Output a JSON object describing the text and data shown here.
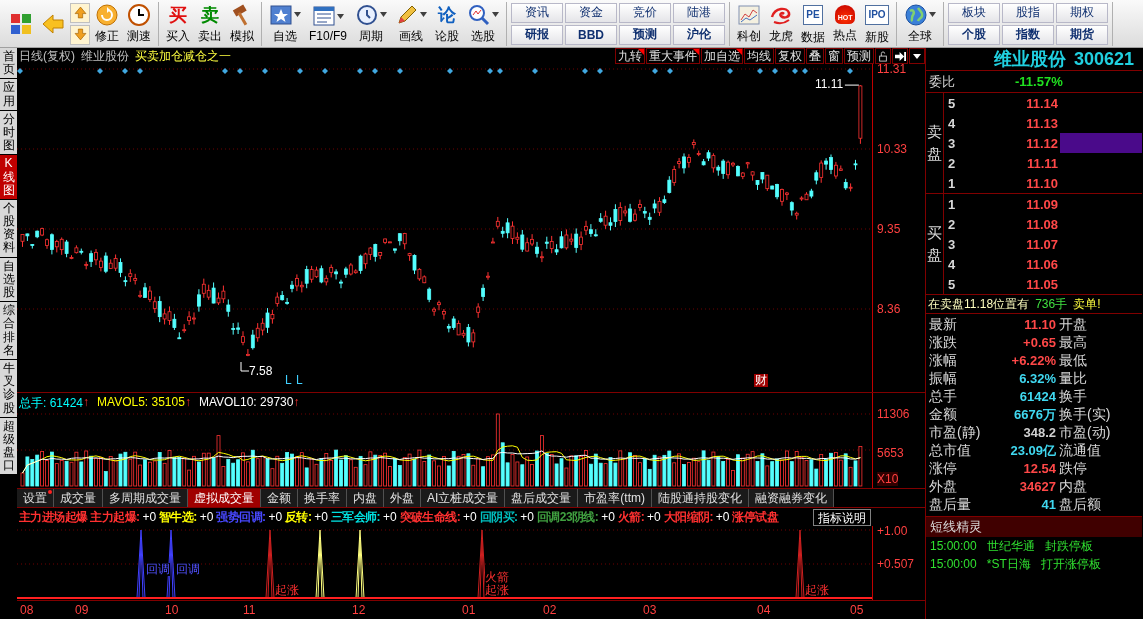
{
  "toolbar": {
    "groups": [
      {
        "items": [
          {
            "kind": "icon"
          },
          {
            "kind": "icon"
          },
          {
            "kind": "updown"
          },
          {
            "kind": "icon",
            "label": "修正"
          },
          {
            "kind": "icon",
            "label": "测速"
          }
        ]
      },
      {
        "items": [
          {
            "kind": "glyph",
            "glyph": "买",
            "color": "#e01010",
            "label": "买入"
          },
          {
            "kind": "glyph",
            "glyph": "卖",
            "color": "#008a00",
            "label": "卖出"
          },
          {
            "kind": "icon",
            "label": "模拟"
          }
        ]
      },
      {
        "items": [
          {
            "kind": "icon",
            "label": "自选",
            "dropdown": true
          },
          {
            "kind": "icon",
            "label": "F10/F9",
            "dropdown": true
          },
          {
            "kind": "icon",
            "label": "周期",
            "dropdown": true
          },
          {
            "kind": "icon",
            "label": "画线",
            "dropdown": true
          },
          {
            "kind": "glyph",
            "glyph": "论",
            "color": "#1060c0",
            "label": "论股"
          },
          {
            "kind": "icon",
            "label": "选股",
            "dropdown": true
          }
        ]
      },
      {
        "items": [
          {
            "kind": "pair",
            "top": "资讯",
            "bottom": "研报"
          },
          {
            "kind": "pair",
            "top": "资金",
            "bottom": "BBD"
          },
          {
            "kind": "pair",
            "top": "竞价",
            "bottom": "预测"
          },
          {
            "kind": "pair",
            "top": "陆港",
            "bottom": "沪伦"
          }
        ]
      },
      {
        "items": [
          {
            "kind": "icon",
            "label": "科创"
          },
          {
            "kind": "icon",
            "label": "龙虎"
          },
          {
            "kind": "badge",
            "glyph": "PE",
            "label": "数据"
          },
          {
            "kind": "flame",
            "glyph": "HOT",
            "label": "热点"
          },
          {
            "kind": "badge",
            "glyph": "IPO",
            "label": "新股"
          }
        ]
      },
      {
        "items": [
          {
            "kind": "icon",
            "label": "全球",
            "dropdown": true
          }
        ]
      },
      {
        "items": [
          {
            "kind": "pair",
            "top": "板块",
            "bottom": "个股"
          },
          {
            "kind": "pair",
            "top": "股指",
            "bottom": "指数"
          },
          {
            "kind": "pair",
            "top": "期权",
            "bottom": "期货"
          }
        ]
      }
    ]
  },
  "left_tabs": [
    {
      "label": "首页",
      "selected": false
    },
    {
      "label": "应用",
      "selected": false
    },
    {
      "label": "分时图",
      "selected": false
    },
    {
      "label": "K线图",
      "selected": true
    },
    {
      "label": "个股资料",
      "selected": false
    },
    {
      "label": "自选股",
      "selected": false
    },
    {
      "label": "综合排名",
      "selected": false
    },
    {
      "label": "牛叉诊股",
      "selected": false
    },
    {
      "label": "超级盘口",
      "selected": false
    }
  ],
  "chart_header": {
    "period": "日线(复权)",
    "stock": "维业股份",
    "indicator": "买卖加仓减仓之一",
    "buttons": [
      {
        "label": "九转",
        "flagged": true
      },
      {
        "label": "重大事件",
        "flagged": true
      },
      {
        "label": "加自选",
        "flagged": true
      },
      {
        "label": "均线",
        "flagged": false
      },
      {
        "label": "复权",
        "flagged": false
      },
      {
        "label": "叠",
        "flagged": false
      },
      {
        "label": "窗",
        "flagged": false
      },
      {
        "label": "预测",
        "flagged": false
      }
    ]
  },
  "main_chart": {
    "y_labels": [
      "11.31",
      "10.33",
      "9.35",
      "8.36"
    ],
    "annotations": [
      {
        "kind": "high",
        "text": "11.11"
      },
      {
        "kind": "low",
        "text": "7.58"
      },
      {
        "kind": "flag",
        "text": "L"
      },
      {
        "kind": "flag",
        "text": "L"
      },
      {
        "kind": "finance",
        "text": "财"
      }
    ]
  },
  "volume_chart": {
    "legend": [
      {
        "label": "总手:",
        "value": "61424",
        "arrow": "↑",
        "color": "#00ffff"
      },
      {
        "label": "MAVOL5:",
        "value": "35105",
        "arrow": "↑",
        "color": "#ffff00"
      },
      {
        "label": "MAVOL10:",
        "value": "29730",
        "arrow": "↑",
        "color": "#ffffff"
      }
    ],
    "y_labels": [
      "11306",
      "5653"
    ],
    "unit": "X10"
  },
  "volume_tabs": [
    {
      "label": "设置",
      "selected": false,
      "flagged": true
    },
    {
      "label": "成交量",
      "selected": false,
      "flagged": false
    },
    {
      "label": "多周期成交量",
      "selected": false,
      "flagged": false
    },
    {
      "label": "虚拟成交量",
      "selected": true,
      "flagged": false
    },
    {
      "label": "金额",
      "selected": false,
      "flagged": false
    },
    {
      "label": "换手率",
      "selected": false,
      "flagged": false
    },
    {
      "label": "内盘",
      "selected": false,
      "flagged": false
    },
    {
      "label": "外盘",
      "selected": false,
      "flagged": false
    },
    {
      "label": "AI立桩成交量",
      "selected": false,
      "flagged": false
    },
    {
      "label": "盘后成交量",
      "selected": false,
      "flagged": false
    },
    {
      "label": "市盈率(ttm)",
      "selected": false,
      "flagged": false
    },
    {
      "label": "陆股通持股变化",
      "selected": false,
      "flagged": false
    },
    {
      "label": "融资融券变化",
      "selected": false,
      "flagged": false
    }
  ],
  "indicator": {
    "legend": [
      {
        "label": "主力进场起爆",
        "color": "#ff3030"
      },
      {
        "label": "主力起爆:",
        "value": "+0",
        "color": "#ff3030"
      },
      {
        "label": "智牛选:",
        "value": "+0",
        "color": "#ffff00"
      },
      {
        "label": "强势回调:",
        "value": "+0",
        "color": "#4848ff"
      },
      {
        "label": "反转:",
        "value": "+0",
        "color": "#ffff00"
      },
      {
        "label": "三军会师:",
        "value": "+0",
        "color": "#00e0e0"
      },
      {
        "label": "突破生命线:",
        "value": "+0",
        "color": "#ff3030"
      },
      {
        "label": "回阴买:",
        "value": "+0",
        "color": "#00c0c0"
      },
      {
        "label": "回调23阴线:",
        "value": "+0",
        "color": "#40a040"
      },
      {
        "label": "火箭:",
        "value": "+0",
        "color": "#ff3030"
      },
      {
        "label": "大阳缩阴:",
        "value": "+0",
        "color": "#ff3030"
      },
      {
        "label": "涨停试盘",
        "color": "#ff3030"
      }
    ],
    "help_button": "指标说明",
    "y_labels": [
      "+1.00",
      "+0.507"
    ],
    "annotations": [
      {
        "kind": "pullback",
        "text": "回调"
      },
      {
        "kind": "pullback",
        "text": "回调"
      },
      {
        "kind": "rise",
        "text": "起涨"
      },
      {
        "kind": "rocket",
        "text": "火箭"
      },
      {
        "kind": "rise",
        "text": "起涨"
      },
      {
        "kind": "rise",
        "text": "起涨"
      }
    ]
  },
  "x_axis": [
    "08",
    "09",
    "10",
    "11",
    "12",
    "01",
    "02",
    "03",
    "04",
    "05"
  ],
  "quote": {
    "title": "维业股份",
    "code": "300621",
    "ratio_label": "委比",
    "ratio_value": "-11.57%",
    "sell": {
      "label": "卖盘",
      "rows": [
        {
          "level": "5",
          "price": "11.14",
          "highlighted": false
        },
        {
          "level": "4",
          "price": "11.13",
          "highlighted": false
        },
        {
          "level": "3",
          "price": "11.12",
          "highlighted": true
        },
        {
          "level": "2",
          "price": "11.11",
          "highlighted": false
        },
        {
          "level": "1",
          "price": "11.10",
          "highlighted": false
        }
      ]
    },
    "buy": {
      "label": "买盘",
      "rows": [
        {
          "level": "1",
          "price": "11.09",
          "highlighted": false
        },
        {
          "level": "2",
          "price": "11.08",
          "highlighted": false
        },
        {
          "level": "3",
          "price": "11.07",
          "highlighted": false
        },
        {
          "level": "4",
          "price": "11.06",
          "highlighted": false
        },
        {
          "level": "5",
          "price": "11.05",
          "highlighted": false
        }
      ]
    },
    "notice": {
      "text": "在卖盘11.18位置有",
      "volume": "736手",
      "suffix": "卖单!"
    },
    "stats": [
      {
        "label": "最新",
        "value": "11.10",
        "color": "#ff4848",
        "label2": "开盘"
      },
      {
        "label": "涨跌",
        "value": "+0.65",
        "color": "#ff4848",
        "label2": "最高"
      },
      {
        "label": "涨幅",
        "value": "+6.22%",
        "color": "#ff4848",
        "label2": "最低"
      },
      {
        "label": "振幅",
        "value": "6.32%",
        "color": "#40d8f0",
        "label2": "量比"
      },
      {
        "label": "总手",
        "value": "61424",
        "color": "#40d8f0",
        "label2": "换手"
      },
      {
        "label": "金额",
        "value": "6676万",
        "color": "#40d8f0",
        "label2": "换手(实)"
      },
      {
        "label": "市盈(静)",
        "value": "348.2",
        "color": "#d0d0d0",
        "label2": "市盈(动)"
      },
      {
        "label": "总市值",
        "value": "23.09亿",
        "color": "#40d8f0",
        "label2": "流通值"
      },
      {
        "label": "涨停",
        "value": "12.54",
        "color": "#ff4848",
        "label2": "跌停"
      },
      {
        "label": "外盘",
        "value": "34627",
        "color": "#ff4848",
        "label2": "内盘"
      },
      {
        "label": "盘后量",
        "value": "41",
        "color": "#40d8f0",
        "label2": "盘后额"
      }
    ],
    "alerts": {
      "title": "短线精灵",
      "rows": [
        {
          "time": "15:00:00",
          "stock": "世纪华通",
          "event": "封跌停板"
        },
        {
          "time": "15:00:00",
          "stock": "*ST日海",
          "event": "打开涨停板"
        }
      ]
    }
  }
}
